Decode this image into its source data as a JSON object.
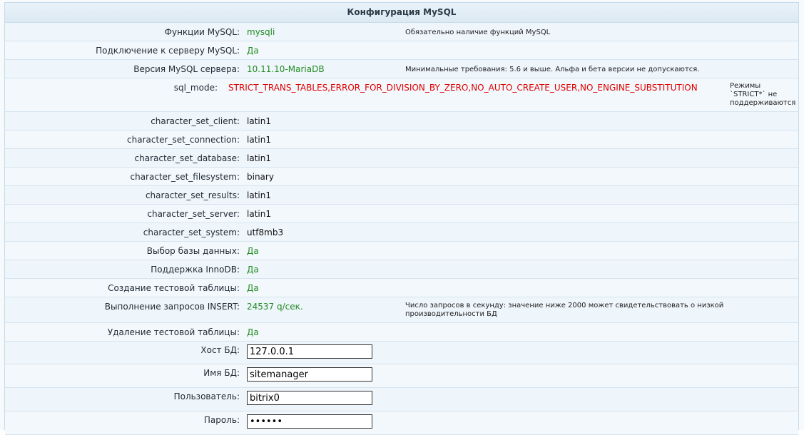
{
  "title": "Конфигурация MySQL",
  "rows": [
    {
      "label": "Функции MySQL:",
      "value": "mysqli",
      "status": "ok",
      "note": "Обязательно наличие функций MySQL"
    },
    {
      "label": "Подключение к серверу MySQL:",
      "value": "Да",
      "status": "ok"
    },
    {
      "label": "Версия MySQL сервера:",
      "value": "10.11.10-MariaDB",
      "status": "ok",
      "note": "Минимальные требования: 5.6 и выше. Альфа и бета версии не допускаются."
    },
    {
      "label": "sql_mode:",
      "value": "STRICT_TRANS_TABLES,ERROR_FOR_DIVISION_BY_ZERO,NO_AUTO_CREATE_USER,NO_ENGINE_SUBSTITUTION",
      "status": "error",
      "note": "Режимы `STRICT*` не поддерживаются"
    },
    {
      "label": "character_set_client:",
      "value": "latin1",
      "status": "plain"
    },
    {
      "label": "character_set_connection:",
      "value": "latin1",
      "status": "plain"
    },
    {
      "label": "character_set_database:",
      "value": "latin1",
      "status": "plain"
    },
    {
      "label": "character_set_filesystem:",
      "value": "binary",
      "status": "plain"
    },
    {
      "label": "character_set_results:",
      "value": "latin1",
      "status": "plain"
    },
    {
      "label": "character_set_server:",
      "value": "latin1",
      "status": "plain"
    },
    {
      "label": "character_set_system:",
      "value": "utf8mb3",
      "status": "plain"
    },
    {
      "label": "Выбор базы данных:",
      "value": "Да",
      "status": "ok"
    },
    {
      "label": "Поддержка InnoDB:",
      "value": "Да",
      "status": "ok"
    },
    {
      "label": "Создание тестовой таблицы:",
      "value": "Да",
      "status": "ok"
    },
    {
      "label": "Выполнение запросов INSERT:",
      "value": "24537 q/сек.",
      "status": "ok",
      "note": "Число запросов в секунду: значение ниже 2000 может свидетельствовать о низкой производительности БД"
    },
    {
      "label": "Удаление тестовой таблицы:",
      "value": "Да",
      "status": "ok"
    }
  ],
  "fields": {
    "host": {
      "label": "Хост БД:",
      "value": "127.0.0.1"
    },
    "dbname": {
      "label": "Имя БД:",
      "value": "sitemanager"
    },
    "user": {
      "label": "Пользователь:",
      "value": "bitrix0"
    },
    "password": {
      "label": "Пароль:",
      "value": "••••••"
    }
  }
}
